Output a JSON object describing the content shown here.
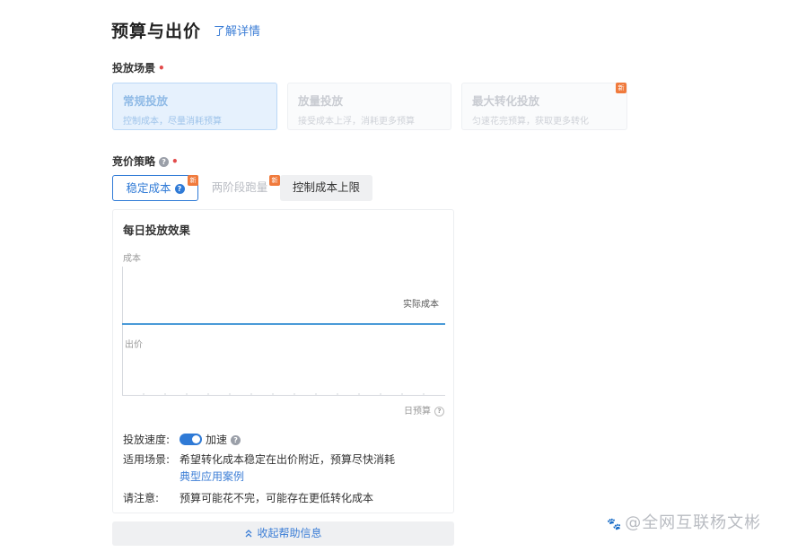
{
  "header": {
    "title": "预算与出价",
    "details_link": "了解详情"
  },
  "scene": {
    "label": "投放场景",
    "required_mark": "•",
    "cards": [
      {
        "title": "常规投放",
        "subtitle": "控制成本，尽量消耗预算",
        "selected": true
      },
      {
        "title": "放量投放",
        "subtitle": "接受成本上浮，消耗更多预算",
        "selected": false
      },
      {
        "title": "最大转化投放",
        "subtitle": "匀速花完预算，获取更多转化",
        "selected": false,
        "badge": "新"
      }
    ]
  },
  "strategy": {
    "label": "竞价策略",
    "required_mark": "•",
    "help": "?",
    "options": [
      {
        "label": "稳定成本",
        "help": "?",
        "badge": "新",
        "selected": true
      },
      {
        "label": "两阶段跑量",
        "badge": "新",
        "selected": false
      },
      {
        "label": "控制成本上限",
        "selected": false
      }
    ]
  },
  "help_panel": {
    "title": "每日投放效果",
    "chart": {
      "upper_label": "成本",
      "line_label": "实际成本",
      "lower_label": "出价",
      "x_label": "日预算",
      "x_help": "?",
      "colors": {
        "line": "#4a9ad8",
        "axis": "#d6d9de"
      }
    },
    "speed": {
      "label": "投放速度:",
      "toggle_on": true,
      "value": "加速",
      "help": "?"
    },
    "scenario": {
      "label": "适用场景:",
      "value": "希望转化成本稳定在出价附近，预算尽快消耗",
      "link": "典型应用案例"
    },
    "note": {
      "label": "请注意:",
      "value": "预算可能花不完，可能存在更低转化成本"
    }
  },
  "collapse": {
    "icon": "double-chevron-up-icon",
    "label": "收起帮助信息"
  },
  "watermark": {
    "glyph": "🐾",
    "text": "@全网互联杨文彬"
  },
  "colors": {
    "accent": "#2f7ad6",
    "link": "#3c7ed6",
    "badge": "#f07a3c",
    "required": "#e24b4b"
  }
}
